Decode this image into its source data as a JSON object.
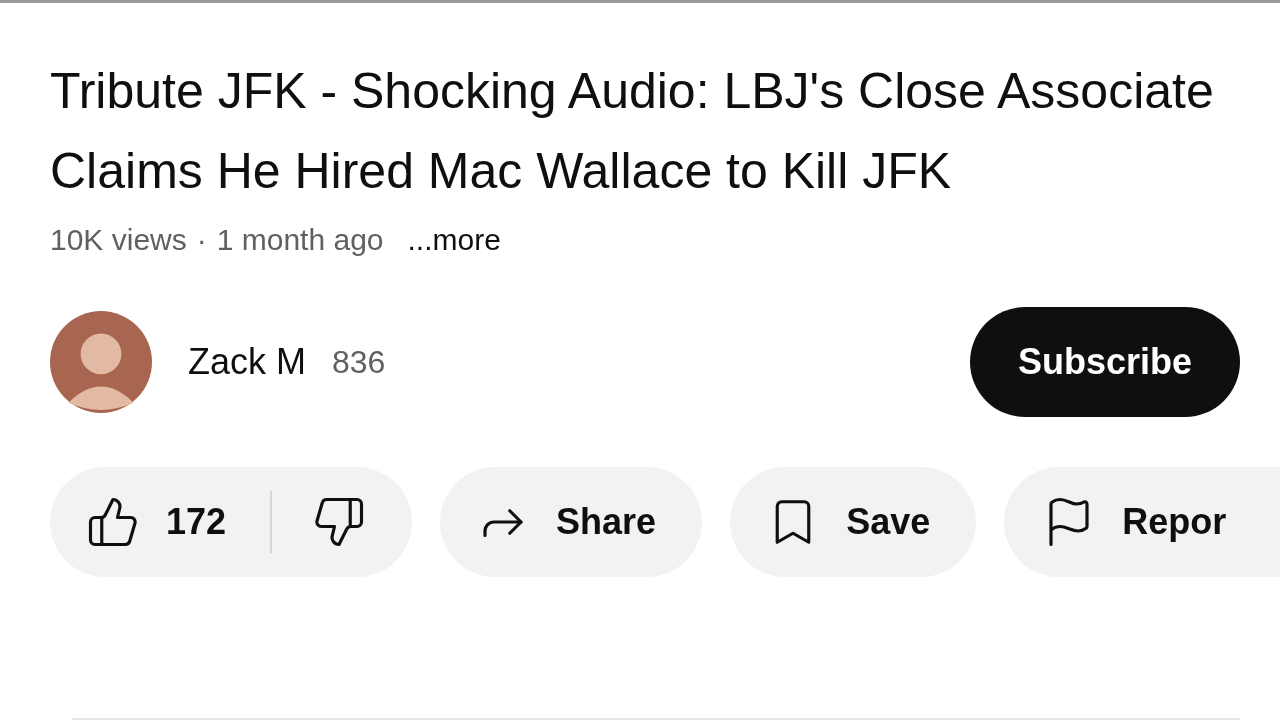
{
  "video": {
    "title": "Tribute JFK - Shocking Audio: LBJ's Close Associate Claims He Hired Mac Wallace to Kill JFK",
    "views": "10K views",
    "separator": "·",
    "age": "1 month ago",
    "more": "...more"
  },
  "channel": {
    "name": "Zack M",
    "subscribers": "836",
    "subscribe": "Subscribe"
  },
  "actions": [
    {
      "kind": "rating",
      "likes": "172"
    },
    {
      "kind": "share",
      "label": "Share"
    },
    {
      "kind": "save",
      "label": "Save"
    },
    {
      "kind": "report",
      "label": "Repor"
    }
  ]
}
